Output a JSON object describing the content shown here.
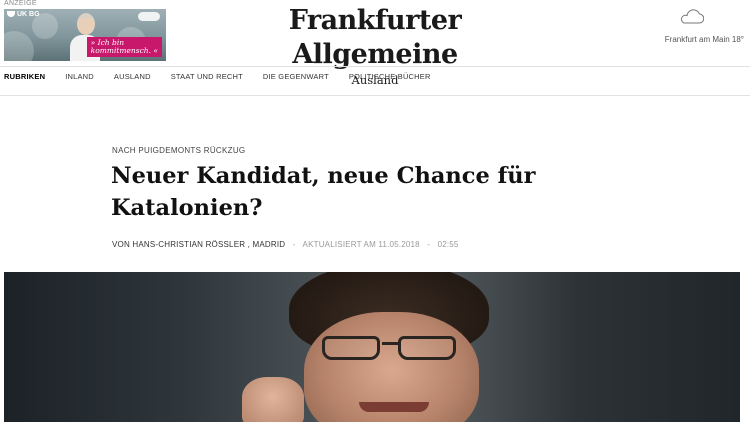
{
  "ad": {
    "label": "ANZEIGE",
    "brand": "UK BG",
    "slogan_line1": "» Ich bin",
    "slogan_line2": "kommitmensch. «"
  },
  "masthead": {
    "title": "Frankfurter Allgemeine",
    "section": "Ausland"
  },
  "weather": {
    "location_temp": "Frankfurt am Main  18°",
    "icon": "cloud-icon"
  },
  "nav": {
    "items": [
      {
        "label": "RUBRIKEN"
      },
      {
        "label": "INLAND"
      },
      {
        "label": "AUSLAND"
      },
      {
        "label": "STAAT UND RECHT"
      },
      {
        "label": "DIE GEGENWART"
      },
      {
        "label": "POLITISCHE BÜCHER"
      }
    ]
  },
  "article": {
    "kicker": "NACH PUIGDEMONTS RÜCKZUG",
    "headline": "Neuer Kandidat, neue Chance für Katalonien?",
    "byline": {
      "author": "VON HANS-CHRISTIAN RÖSSLER , MADRID",
      "sep1": "-",
      "updated": "AKTUALISIERT AM 11.05.2018",
      "sep2": "-",
      "time": "02:55"
    }
  },
  "colors": {
    "ad_slogan": "#c8186c",
    "rule": "#e2e2e2"
  }
}
